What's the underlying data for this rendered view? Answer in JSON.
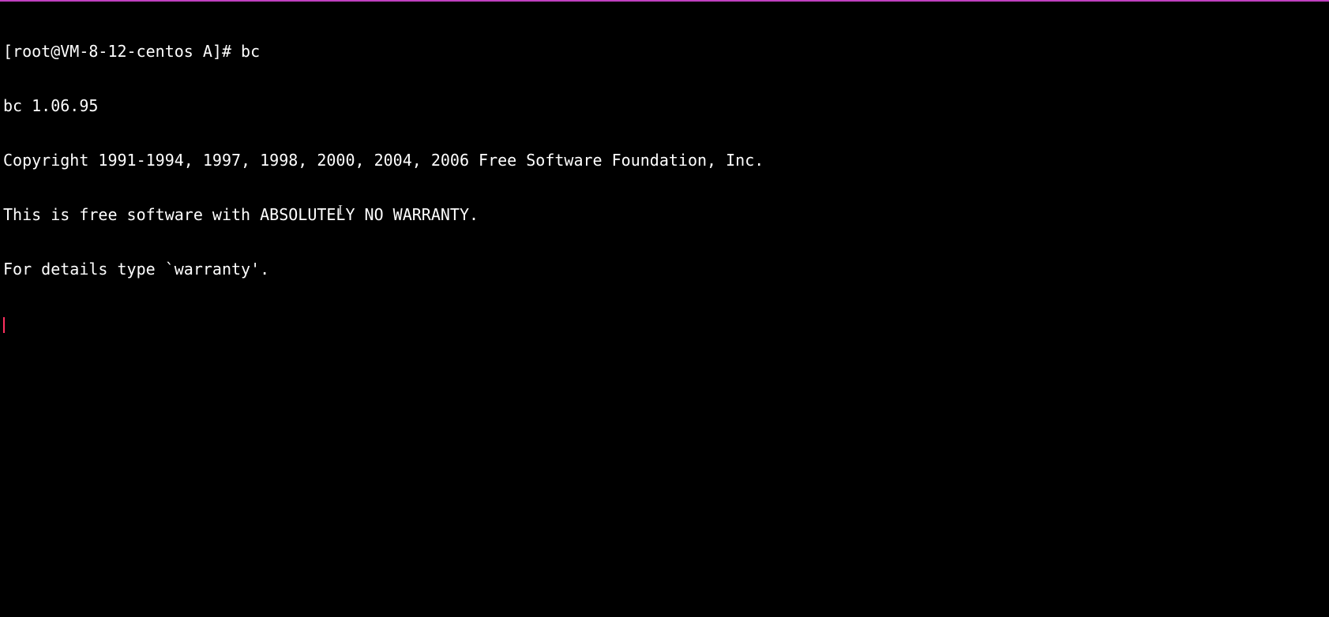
{
  "terminal": {
    "lines": [
      "[root@VM-8-12-centos A]# bc",
      "bc 1.06.95",
      "Copyright 1991-1994, 1997, 1998, 2000, 2004, 2006 Free Software Foundation, Inc.",
      "This is free software with ABSOLUTELY NO WARRANTY.",
      "For details type `warranty'."
    ],
    "cursor_glyph": "I"
  }
}
